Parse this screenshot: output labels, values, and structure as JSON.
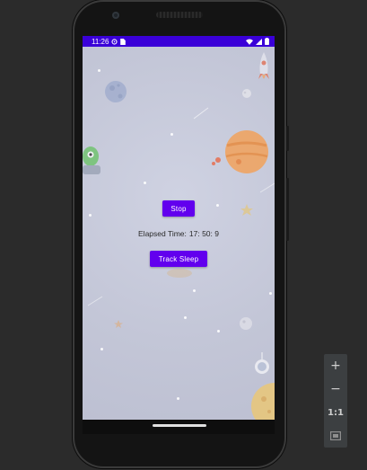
{
  "status_bar": {
    "time": "11:26",
    "icons": [
      "settings-gear-icon",
      "sim-card-icon",
      "wifi-icon",
      "signal-icon",
      "battery-icon"
    ]
  },
  "app": {
    "stop_label": "Stop",
    "elapsed_label": "Elapsed Time:",
    "elapsed_value": "17: 50: 9",
    "track_sleep_label": "Track Sleep",
    "button_color": "#6200ee",
    "status_bar_color": "#3a00d8"
  },
  "emulator_controls": {
    "zoom_in": "+",
    "zoom_out": "−",
    "actual_size": "1:1",
    "fit_screen_icon": "fit-screen-icon"
  }
}
